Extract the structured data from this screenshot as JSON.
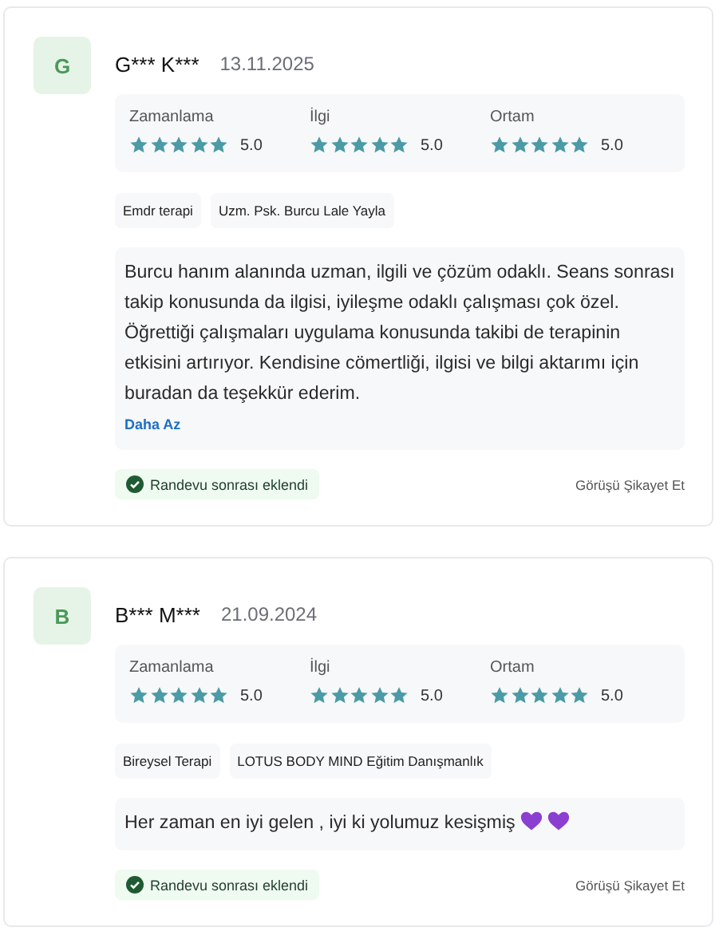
{
  "reviews": [
    {
      "initial": "G",
      "name": "G*** K***",
      "date": "13.11.2025",
      "ratings": [
        {
          "label": "Zamanlama",
          "stars": 5,
          "score": "5.0"
        },
        {
          "label": "İlgi",
          "stars": 5,
          "score": "5.0"
        },
        {
          "label": "Ortam",
          "stars": 5,
          "score": "5.0"
        }
      ],
      "tags": [
        "Emdr terapi",
        "Uzm. Psk. Burcu Lale Yayla"
      ],
      "text": "Burcu hanım alanında uzman, ilgili ve çözüm odaklı. Seans sonrası takip konusunda da ilgisi, iyileşme odaklı çalışması çok özel. Öğrettiği çalışmaları uygulama konusunda takibi de terapinin etkisini artırıyor. Kendisine cömertliği, ilgisi ve bilgi aktarımı için buradan da teşekkür ederim.",
      "toggle_link": "Daha Az",
      "badge": "Randevu sonrası eklendi",
      "report_link": "Görüşü Şikayet Et"
    },
    {
      "initial": "B",
      "name": "B*** M***",
      "date": "21.09.2024",
      "ratings": [
        {
          "label": "Zamanlama",
          "stars": 5,
          "score": "5.0"
        },
        {
          "label": "İlgi",
          "stars": 5,
          "score": "5.0"
        },
        {
          "label": "Ortam",
          "stars": 5,
          "score": "5.0"
        }
      ],
      "tags": [
        "Bireysel Terapi",
        "LOTUS BODY MIND Eğitim Danışmanlık"
      ],
      "text": "Her zaman en iyi gelen , iyi ki yolumuz kesişmiş",
      "trailing_icons": [
        {
          "kind": "heart"
        },
        {
          "kind": "heart"
        }
      ],
      "badge": "Randevu sonrası eklendi",
      "report_link": "Görüşü Şikayet Et"
    }
  ]
}
